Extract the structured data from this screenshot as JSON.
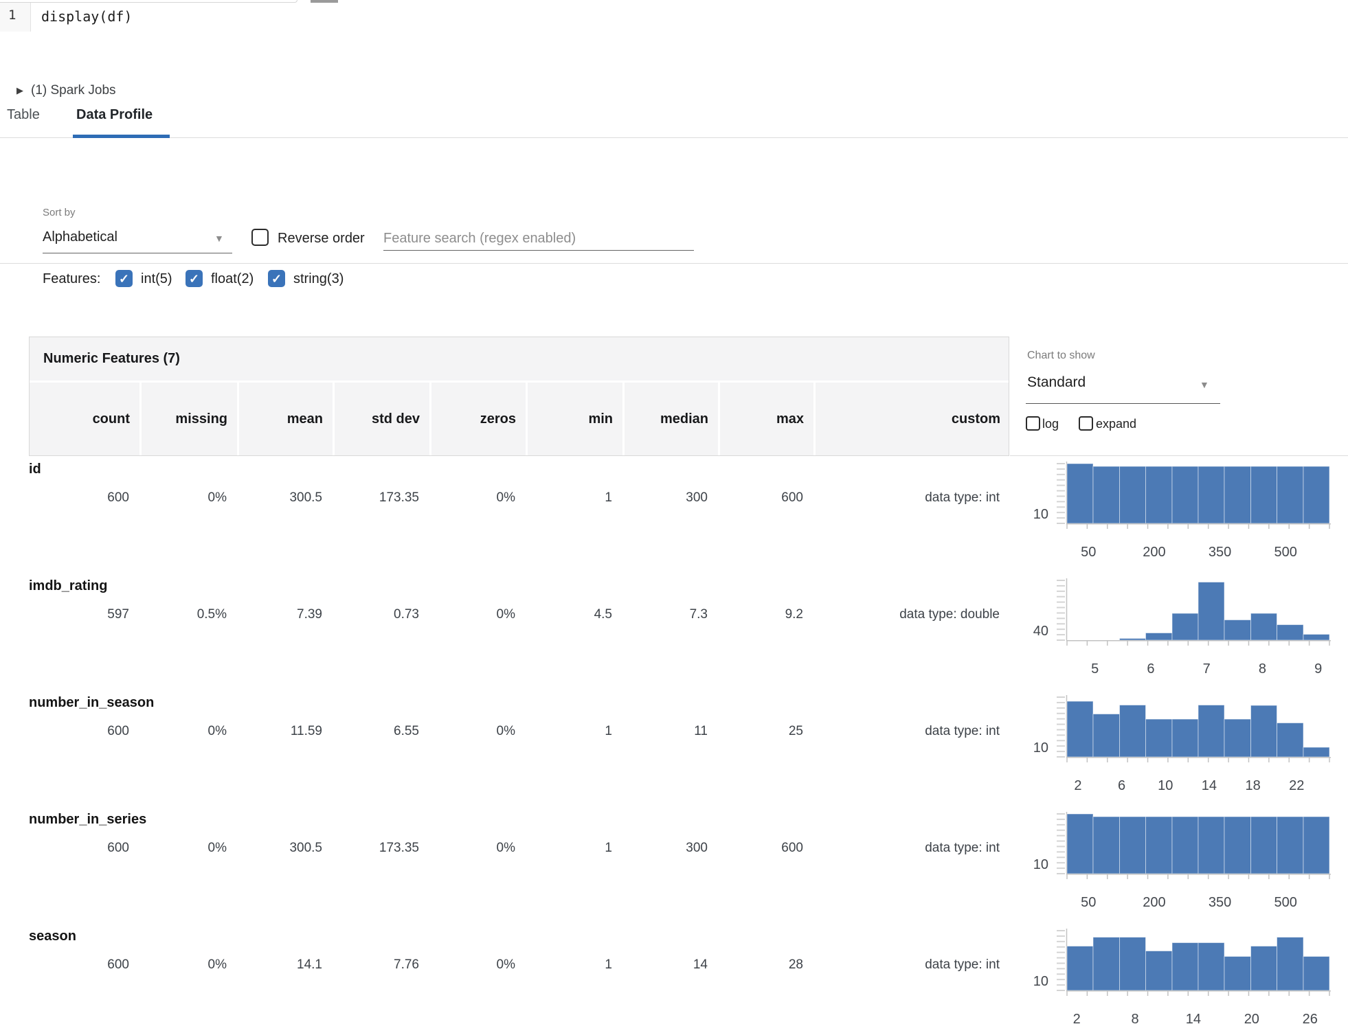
{
  "code_cell": {
    "line_number": "1",
    "code": "display(df)"
  },
  "spark_jobs": {
    "label": "(1) Spark Jobs"
  },
  "tabs": [
    {
      "label": "Table",
      "active": false
    },
    {
      "label": "Data Profile",
      "active": true
    }
  ],
  "controls": {
    "sort_by_label": "Sort by",
    "sort_value": "Alphabetical",
    "reverse_order_label": "Reverse order",
    "search_placeholder": "Feature search (regex enabled)"
  },
  "features_filter": {
    "label": "Features:",
    "options": [
      {
        "label": "int(5)",
        "checked": true
      },
      {
        "label": "float(2)",
        "checked": true
      },
      {
        "label": "string(3)",
        "checked": true
      }
    ]
  },
  "table": {
    "title": "Numeric Features (7)",
    "columns": [
      "count",
      "missing",
      "mean",
      "std dev",
      "zeros",
      "min",
      "median",
      "max",
      "custom"
    ],
    "rows": [
      {
        "name": "id",
        "count": "600",
        "missing": "0%",
        "mean": "300.5",
        "std_dev": "173.35",
        "zeros": "0%",
        "min": "1",
        "median": "300",
        "max": "600",
        "custom": "data type: int"
      },
      {
        "name": "imdb_rating",
        "count": "597",
        "missing": "0.5%",
        "mean": "7.39",
        "std_dev": "0.73",
        "zeros": "0%",
        "min": "4.5",
        "median": "7.3",
        "max": "9.2",
        "custom": "data type: double"
      },
      {
        "name": "number_in_season",
        "count": "600",
        "missing": "0%",
        "mean": "11.59",
        "std_dev": "6.55",
        "zeros": "0%",
        "min": "1",
        "median": "11",
        "max": "25",
        "custom": "data type: int"
      },
      {
        "name": "number_in_series",
        "count": "600",
        "missing": "0%",
        "mean": "300.5",
        "std_dev": "173.35",
        "zeros": "0%",
        "min": "1",
        "median": "300",
        "max": "600",
        "custom": "data type: int"
      },
      {
        "name": "season",
        "count": "600",
        "missing": "0%",
        "mean": "14.1",
        "std_dev": "7.76",
        "zeros": "0%",
        "min": "1",
        "median": "14",
        "max": "28",
        "custom": "data type: int"
      }
    ]
  },
  "chart_controls": {
    "label": "Chart to show",
    "value": "Standard",
    "checkboxes": [
      {
        "label": "log",
        "checked": false
      },
      {
        "label": "expand",
        "checked": false
      }
    ]
  },
  "chart_data": [
    {
      "type": "histogram",
      "feature": "id",
      "x_range": [
        1,
        600
      ],
      "x_ticks": [
        50,
        200,
        350,
        500
      ],
      "y_axis_tick": "10",
      "rel_heights": [
        1,
        0.955,
        0.955,
        0.955,
        0.955,
        0.955,
        0.955,
        0.955,
        0.955,
        0.955
      ]
    },
    {
      "type": "histogram",
      "feature": "imdb_rating",
      "x_range": [
        4.5,
        9.2
      ],
      "x_ticks": [
        5,
        6,
        7,
        8,
        9
      ],
      "y_axis_tick": "40",
      "rel_heights": [
        0,
        0,
        0.03,
        0.12,
        0.45,
        0.97,
        0.34,
        0.45,
        0.26,
        0.1
      ]
    },
    {
      "type": "histogram",
      "feature": "number_in_season",
      "x_range": [
        1,
        25
      ],
      "x_ticks": [
        2,
        6,
        10,
        14,
        18,
        22
      ],
      "y_axis_tick": "10",
      "rel_heights": [
        0.93,
        0.72,
        0.87,
        0.63,
        0.63,
        0.87,
        0.63,
        0.86,
        0.57,
        0.16
      ]
    },
    {
      "type": "histogram",
      "feature": "number_in_series",
      "x_range": [
        1,
        600
      ],
      "x_ticks": [
        50,
        200,
        350,
        500
      ],
      "y_axis_tick": "10",
      "rel_heights": [
        1,
        0.955,
        0.955,
        0.955,
        0.955,
        0.955,
        0.955,
        0.955,
        0.955,
        0.955
      ]
    },
    {
      "type": "histogram",
      "feature": "season",
      "x_range": [
        1,
        28
      ],
      "x_ticks": [
        2,
        8,
        14,
        20,
        26
      ],
      "y_axis_tick": "10",
      "rel_heights": [
        0.74,
        0.89,
        0.89,
        0.66,
        0.8,
        0.8,
        0.57,
        0.74,
        0.89,
        0.57
      ]
    }
  ],
  "colors": {
    "histogram_bar": "#4c7ab5",
    "histogram_bar_divider": "rgba(255,255,255,0.5)",
    "tab_accent": "#2e6cb5",
    "checkbox_checked": "#3a73b9",
    "panel_bg": "#f4f4f5",
    "panel_border": "#d8d8d8",
    "axis_gray": "#c2c2c2"
  }
}
